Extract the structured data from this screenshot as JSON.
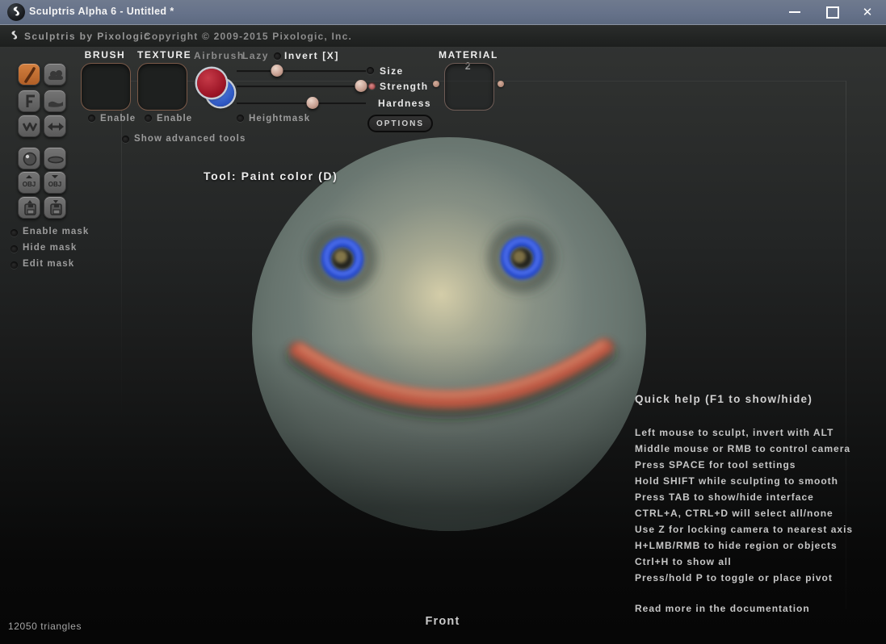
{
  "window": {
    "title": "Sculptris Alpha 6 - Untitled *",
    "close_glyph": "✕"
  },
  "infobar": {
    "brand": "Sculptris by Pixologic",
    "copyright": "Copyright © 2009-2015 Pixologic, Inc."
  },
  "toolbar": {
    "brush": {
      "label": "BRUSH",
      "enable": "Enable"
    },
    "texture": {
      "label": "TEXTURE",
      "enable": "Enable"
    },
    "airbrush": "Airbrush",
    "lazy": "Lazy",
    "invert": "Invert [X]",
    "sliders": [
      {
        "label": "Size",
        "handle_left": "31%",
        "active": false
      },
      {
        "label": "Strength",
        "handle_left": "96%",
        "active": true
      },
      {
        "label": "Hardness",
        "handle_left": "59%",
        "active": false
      }
    ],
    "heightmask": "Heightmask",
    "material": {
      "label": "MATERIAL 2"
    },
    "options": "OPTIONS",
    "advanced": "Show advanced tools"
  },
  "left_tools": {
    "obj_label": "OBJ",
    "buttons": [
      {
        "icon": "paint-brush-icon",
        "active": true
      },
      {
        "icon": "bump-brush-icon",
        "active": false
      },
      {
        "icon": "fill-tool-icon",
        "active": false
      },
      {
        "icon": "flatten-brush-icon",
        "active": false
      },
      {
        "icon": "wireframe-icon",
        "active": false
      },
      {
        "icon": "symmetry-icon",
        "active": false
      },
      {
        "icon": "new-sphere-icon",
        "active": false
      },
      {
        "icon": "new-plane-icon",
        "active": false
      },
      {
        "icon": "import-obj-icon",
        "active": false
      },
      {
        "icon": "export-obj-icon",
        "active": false
      },
      {
        "icon": "open-file-icon",
        "active": false
      },
      {
        "icon": "save-file-icon",
        "active": false
      }
    ]
  },
  "mask": {
    "items": [
      "Enable mask",
      "Hide mask",
      "Edit mask"
    ]
  },
  "viewport": {
    "tool_label": "Tool: Paint color (D)",
    "orientation_label": "Front",
    "triangle_count": "12050 triangles"
  },
  "help": {
    "title": "Quick help (F1 to show/hide)",
    "lines": [
      "Left mouse to sculpt, invert with ALT",
      "Middle mouse or RMB to control camera",
      "Press SPACE for tool settings",
      "Hold SHIFT while sculpting to smooth",
      "Press TAB to show/hide interface",
      "CTRL+A, CTRL+D will select all/none",
      "Use Z for locking camera to nearest axis",
      "H+LMB/RMB to hide region or objects",
      "Ctrl+H to show all",
      "Press/hold P to toggle or place pivot"
    ],
    "footer": "Read more in the documentation"
  },
  "colors": {
    "titlebar": "#66728a",
    "active_tool_orange": "#c4713b",
    "paint_red": "#9c1526",
    "paint_blue": "#2c55c0",
    "eye_blue": "#2f52d4",
    "smile_red": "#bf5a46",
    "strength_dot": "#c96a6a"
  }
}
